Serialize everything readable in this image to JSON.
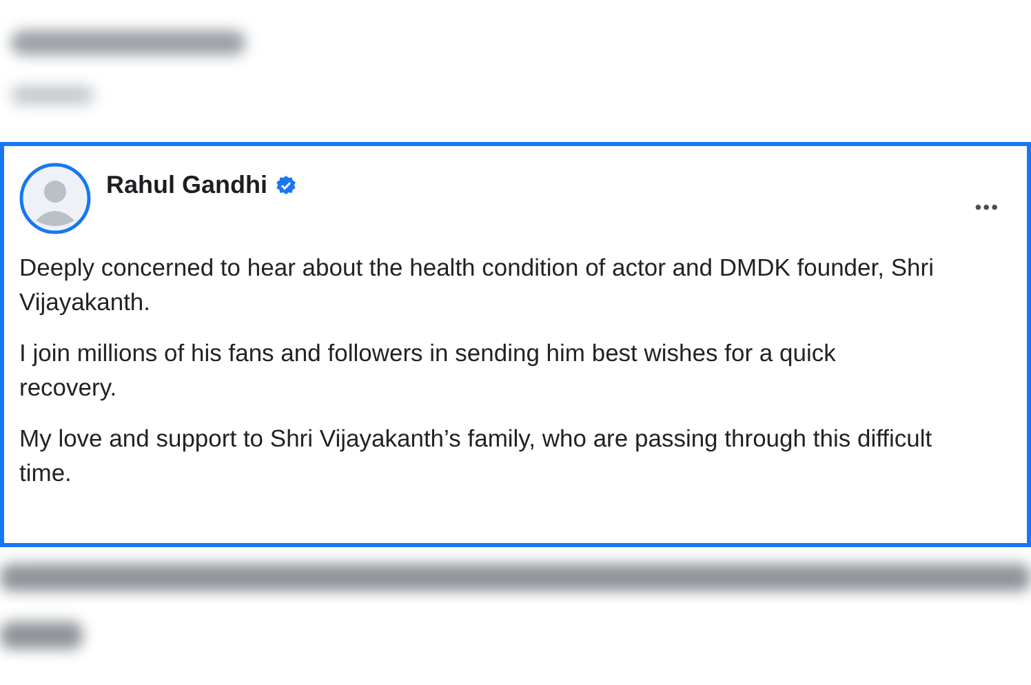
{
  "post": {
    "author": "Rahul Gandhi",
    "verified": true,
    "more_button": "•••",
    "paragraphs": [
      "Deeply concerned to hear about the health condition of actor and DMDK founder, Shri Vijayakanth.",
      "I join millions of his fans and followers in sending him best wishes for a quick recovery.",
      "My love and support to Shri Vijayakanth’s family, who are passing through this difficult time."
    ]
  }
}
